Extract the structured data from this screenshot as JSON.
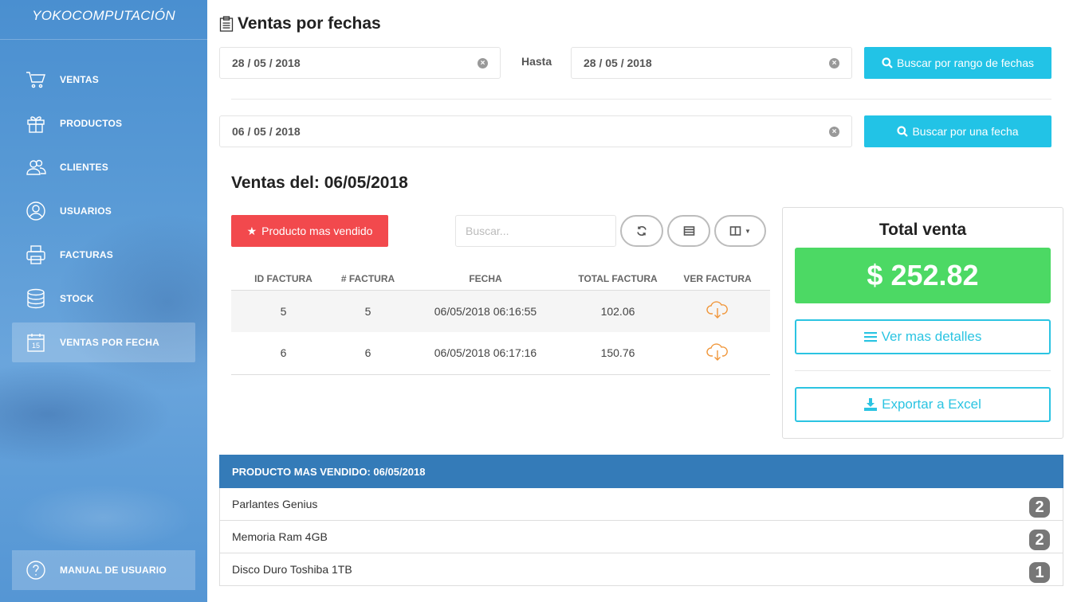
{
  "sidebar": {
    "brand": "YOKOCOMPUTACIÓN",
    "items": [
      {
        "label": "VENTAS",
        "icon": "cart-icon"
      },
      {
        "label": "PRODUCTOS",
        "icon": "gift-icon"
      },
      {
        "label": "CLIENTES",
        "icon": "users-icon"
      },
      {
        "label": "USUARIOS",
        "icon": "user-icon"
      },
      {
        "label": "FACTURAS",
        "icon": "printer-icon"
      },
      {
        "label": "STOCK",
        "icon": "database-icon"
      },
      {
        "label": "VENTAS POR FECHA",
        "icon": "calendar-icon",
        "active": true
      }
    ],
    "manual": {
      "label": "MANUAL DE USUARIO",
      "icon": "help-icon"
    }
  },
  "header": {
    "title": "Ventas por fechas"
  },
  "range": {
    "from": "28 / 05 / 2018",
    "hasta_label": "Hasta",
    "to": "28 / 05 / 2018",
    "button": "Buscar por rango de fechas"
  },
  "single": {
    "date": "06 / 05 / 2018",
    "button": "Buscar por una fecha"
  },
  "sales": {
    "heading": "Ventas del: 06/05/2018",
    "best_button": "Producto mas vendido",
    "search_placeholder": "Buscar...",
    "columns": [
      "ID FACTURA",
      "# FACTURA",
      "FECHA",
      "TOTAL FACTURA",
      "VER FACTURA"
    ],
    "rows": [
      {
        "id": "5",
        "num": "5",
        "fecha": "06/05/2018 06:16:55",
        "total": "102.06"
      },
      {
        "id": "6",
        "num": "6",
        "fecha": "06/05/2018 06:17:16",
        "total": "150.76"
      }
    ]
  },
  "total": {
    "title": "Total venta",
    "amount": "$ 252.82",
    "details_button": "Ver mas detalles",
    "excel_button": "Exportar a Excel"
  },
  "best_sellers": {
    "heading": "PRODUCTO MAS VENDIDO: 06/05/2018",
    "items": [
      {
        "name": "Parlantes Genius",
        "count": "2"
      },
      {
        "name": "Memoria Ram 4GB",
        "count": "2"
      },
      {
        "name": "Disco Duro Toshiba 1TB",
        "count": "1"
      }
    ]
  },
  "colors": {
    "sidebar": "#5a9bd6",
    "accent_cyan": "#22c3e6",
    "danger": "#f2494d",
    "success": "#4cd964",
    "panel_header": "#347bb8",
    "cloud": "#f0963a"
  }
}
